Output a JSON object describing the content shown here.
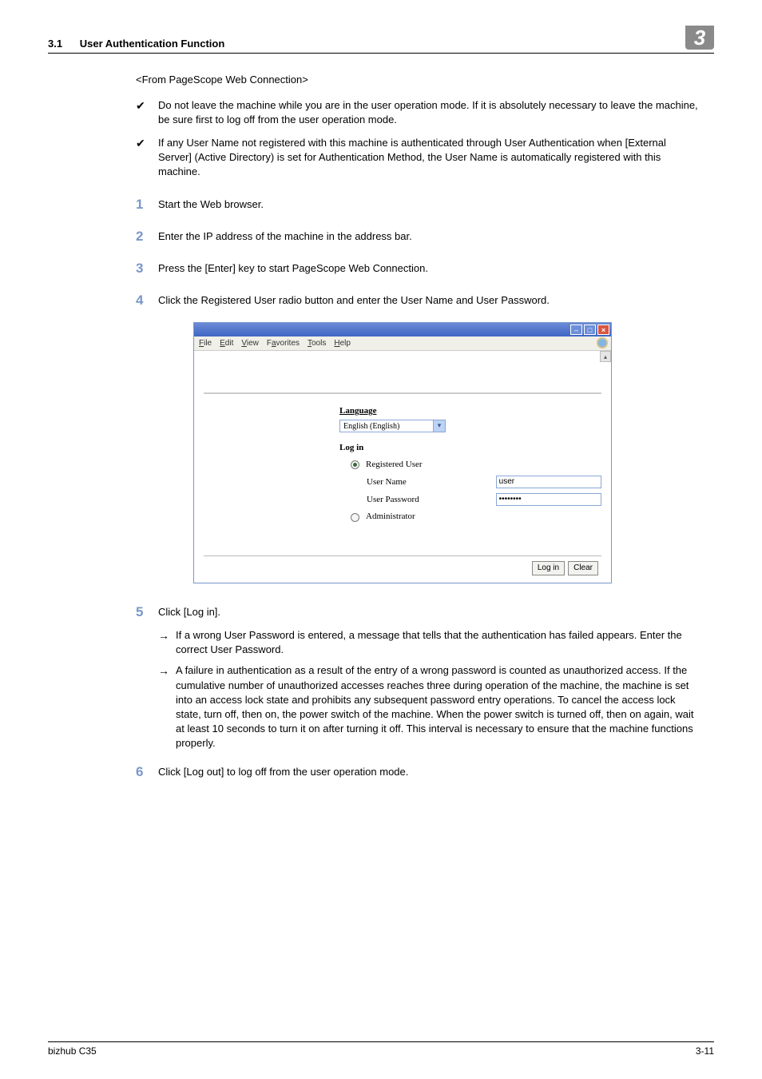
{
  "header": {
    "section_no": "3.1",
    "section_title": "User Authentication Function",
    "chapter_badge": "3"
  },
  "subhead": "<From PageScope Web Connection>",
  "checks": [
    "Do not leave the machine while you are in the user operation mode. If it is absolutely necessary to leave the machine, be sure first to log off from the user operation mode.",
    "If any User Name not registered with this machine is authenticated through User Authentication when [External Server] (Active Directory) is set for Authentication Method, the User Name is automatically registered with this machine."
  ],
  "steps": {
    "s1": {
      "n": "1",
      "t": "Start the Web browser."
    },
    "s2": {
      "n": "2",
      "t": "Enter the IP address of the machine in the address bar."
    },
    "s3": {
      "n": "3",
      "t": "Press the [Enter] key to start PageScope Web Connection."
    },
    "s4": {
      "n": "4",
      "t": "Click the Registered User radio button and enter the User Name and User Password."
    },
    "s5": {
      "n": "5",
      "t": "Click [Log in]."
    },
    "s6": {
      "n": "6",
      "t": "Click [Log out] to log off from the user operation mode."
    }
  },
  "arrows5": [
    "If a wrong User Password is entered, a message that tells that the authentication has failed appears. Enter the correct User Password.",
    "A failure in authentication as a result of the entry of a wrong password is counted as unauthorized access. If the cumulative number of unauthorized accesses reaches three during operation of the machine, the machine is set into an access lock state and prohibits any subsequent password entry operations. To cancel the access lock state, turn off, then on, the power switch of the machine. When the power switch is turned off, then on again, wait at least 10 seconds to turn it on after turning it off. This interval is necessary to ensure that the machine functions properly."
  ],
  "browser": {
    "menu": {
      "file": "File",
      "edit": "Edit",
      "view": "View",
      "favorites": "Favorites",
      "tools": "Tools",
      "help": "Help"
    },
    "lang_label": "Language",
    "lang_value": "English (English)",
    "login_label": "Log in",
    "opt_registered": "Registered User",
    "opt_admin": "Administrator",
    "username_label": "User Name",
    "username_value": "user",
    "password_label": "User Password",
    "password_value": "••••••••",
    "btn_login": "Log in",
    "btn_clear": "Clear"
  },
  "footer": {
    "left": "bizhub C35",
    "right": "3-11"
  }
}
